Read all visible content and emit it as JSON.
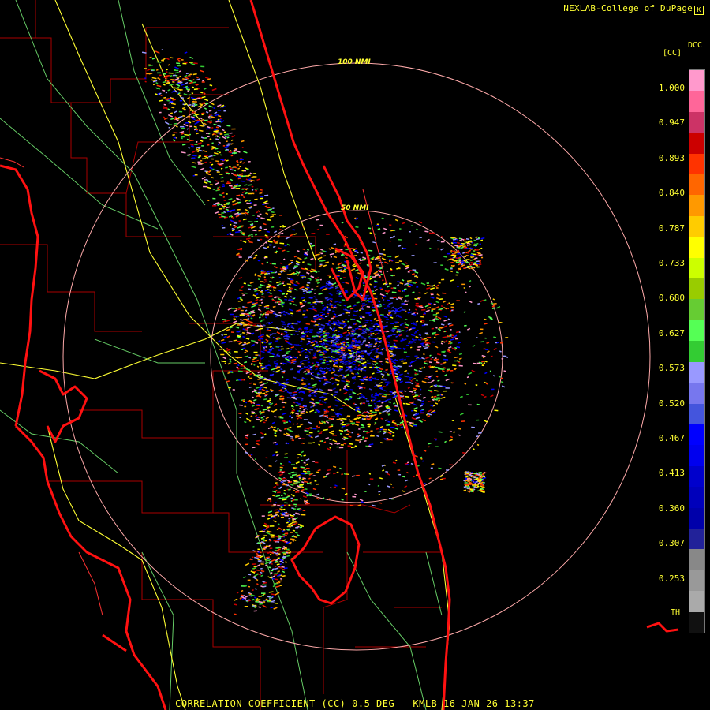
{
  "credit": "NEXLAB-College of DuPage",
  "caption": "CORRELATION COEFFICIENT (CC) 0.5 DEG - KMLB 16 JAN 26 13:37",
  "range_rings": [
    "100 NMI",
    "50 NMI"
  ],
  "legend": {
    "product": "DCC",
    "unit": "[CC]",
    "ticks": [
      "1.000",
      "0.947",
      "0.893",
      "0.840",
      "0.787",
      "0.733",
      "0.680",
      "0.627",
      "0.573",
      "0.520",
      "0.467",
      "0.413",
      "0.360",
      "0.307",
      "0.253"
    ],
    "bottom_label": "TH",
    "colors": [
      "#ff99cc",
      "#ff6699",
      "#cc3366",
      "#cc0000",
      "#ff3300",
      "#ff6600",
      "#ff9900",
      "#ffcc00",
      "#ffff00",
      "#ccff00",
      "#99cc00",
      "#66cc33",
      "#55ff55",
      "#33cc33",
      "#9999ff",
      "#7777ee",
      "#4455dd",
      "#0000ff",
      "#0000ee",
      "#0000cc",
      "#0000bb",
      "#0000aa",
      "#222299",
      "#888888",
      "#999999",
      "#aaaaaa",
      "#111111"
    ]
  },
  "colors": {
    "state_lines": "#ff0000",
    "county_lines": "#aa0000",
    "roads_major": "#ffff33",
    "roads_minor": "#66cc66",
    "range_rings": "#ffaaaa",
    "text": "#ffff33"
  }
}
